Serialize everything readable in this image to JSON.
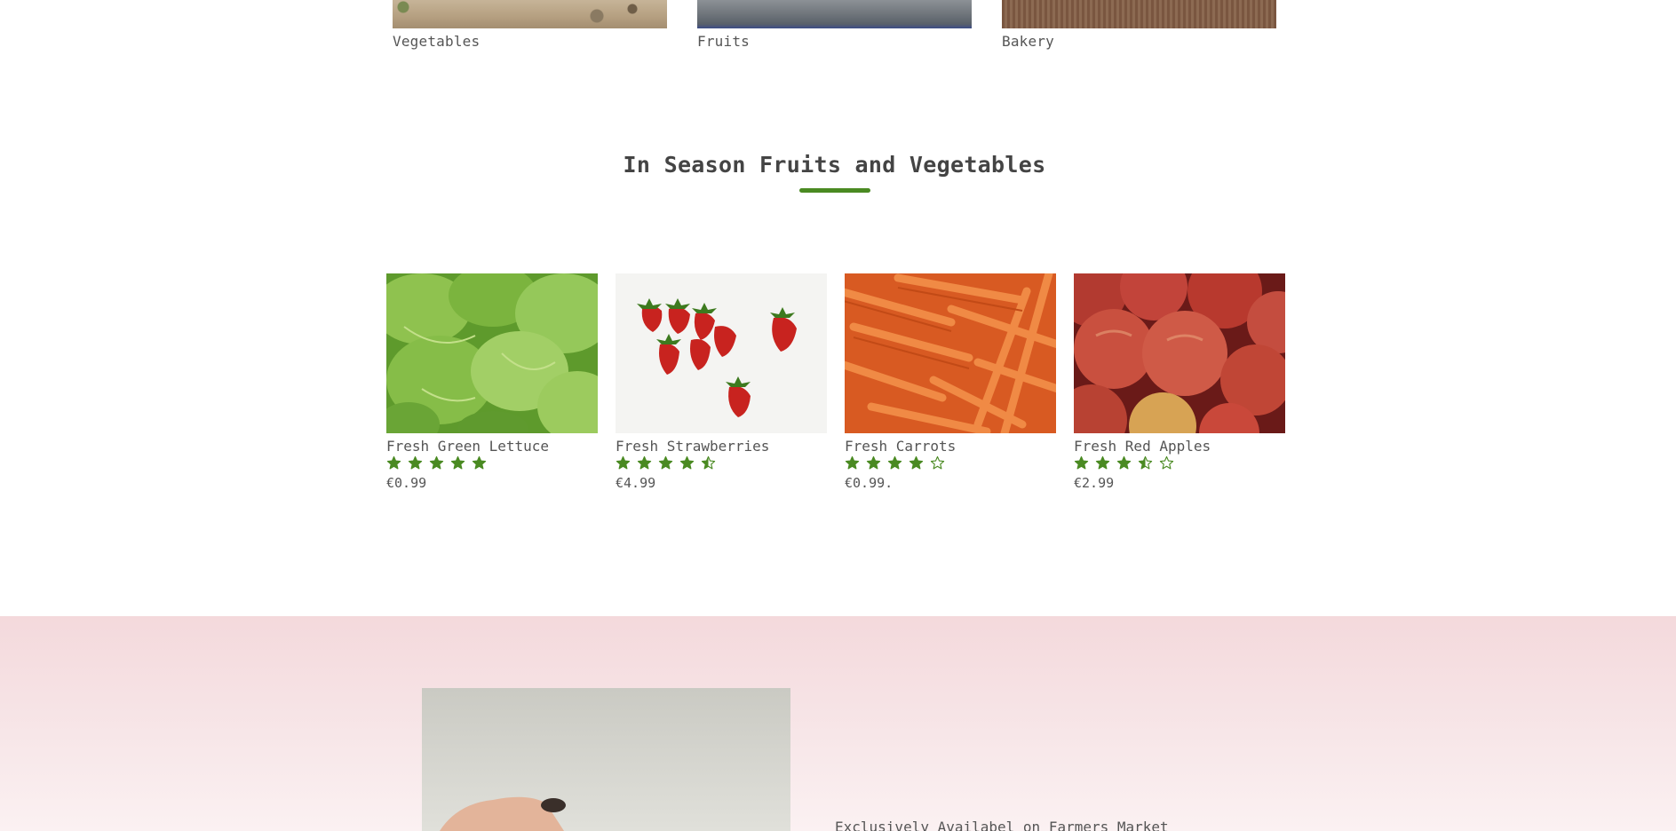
{
  "categories": [
    {
      "label": "Vegetables"
    },
    {
      "label": "Fruits"
    },
    {
      "label": "Bakery"
    }
  ],
  "section": {
    "title": "In Season Fruits and Vegetables",
    "accent_color": "#4a8a22"
  },
  "products": [
    {
      "name": "Fresh Green Lettuce",
      "rating": 5,
      "price": "€0.99"
    },
    {
      "name": "Fresh Strawberries",
      "rating": 4.5,
      "price": "€4.99"
    },
    {
      "name": "Fresh Carrots",
      "rating": 4,
      "price": "€0.99."
    },
    {
      "name": "Fresh Red Apples",
      "rating": 3.5,
      "price": "€2.99"
    }
  ],
  "promo": {
    "text": "Exclusively Availabel on Farmers Market"
  },
  "star_icon": "star-icon",
  "star_color": "#4a8a22"
}
